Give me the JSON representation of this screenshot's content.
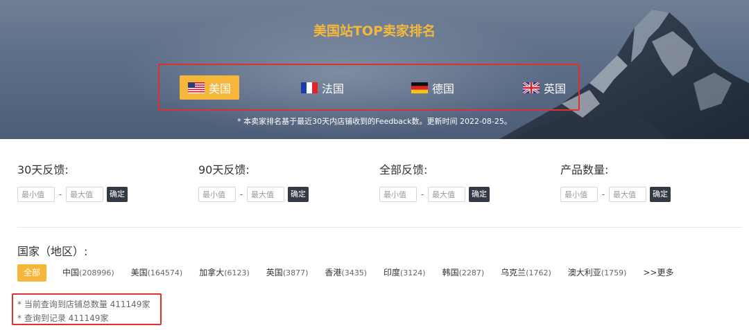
{
  "hero": {
    "title": "美国站TOP卖家排名",
    "tabs": [
      {
        "label": "美国",
        "flag": "us-flag",
        "active": true
      },
      {
        "label": "法国",
        "flag": "fr-flag",
        "active": false
      },
      {
        "label": "德国",
        "flag": "de-flag",
        "active": false
      },
      {
        "label": "英国",
        "flag": "uk-flag",
        "active": false
      }
    ],
    "note": "* 本卖家排名基于最近30天内店铺收到的Feedback数。更新时间 2022-08-25。"
  },
  "filters": [
    {
      "label": "30天反馈:",
      "min_placeholder": "最小值",
      "max_placeholder": "最大值",
      "confirm": "确定"
    },
    {
      "label": "90天反馈:",
      "min_placeholder": "最小值",
      "max_placeholder": "最大值",
      "confirm": "确定"
    },
    {
      "label": "全部反馈:",
      "min_placeholder": "最小值",
      "max_placeholder": "最大值",
      "confirm": "确定"
    },
    {
      "label": "产品数量:",
      "min_placeholder": "最小值",
      "max_placeholder": "最大值",
      "confirm": "确定"
    }
  ],
  "region": {
    "label": "国家（地区）:",
    "all": "全部",
    "items": [
      {
        "name": "中国",
        "count": "(208996)"
      },
      {
        "name": "美国",
        "count": "(164574)"
      },
      {
        "name": "加拿大",
        "count": "(6123)"
      },
      {
        "name": "英国",
        "count": "(3877)"
      },
      {
        "name": "香港",
        "count": "(3435)"
      },
      {
        "name": "印度",
        "count": "(3124)"
      },
      {
        "name": "韩国",
        "count": "(2287)"
      },
      {
        "name": "乌克兰",
        "count": "(1762)"
      },
      {
        "name": "澳大利亚",
        "count": "(1759)"
      }
    ],
    "more": ">>更多"
  },
  "results": {
    "total_shops": "* 当前查询到店铺总数量 411149家",
    "records": "* 查询到记录 411149家"
  },
  "colors": {
    "accent": "#f6b63a",
    "title": "#f5b83b",
    "highlight_border": "#e02f2f",
    "confirm_button": "#333a45"
  }
}
